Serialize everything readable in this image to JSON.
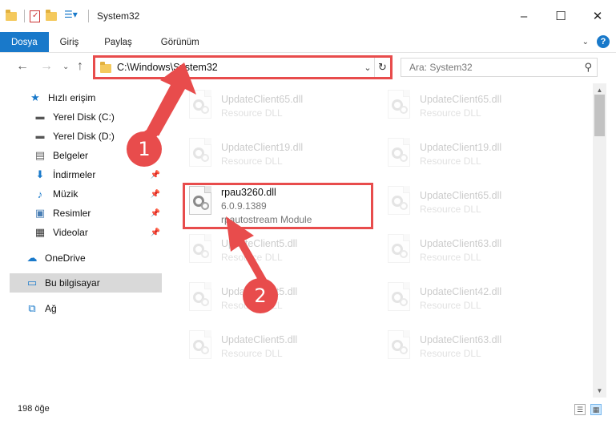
{
  "window": {
    "title": "System32",
    "controls": [
      "–",
      "☐",
      "✕"
    ]
  },
  "ribbon": {
    "tabs": [
      "Dosya",
      "Giriş",
      "Paylaş",
      "Görünüm"
    ],
    "help": "?"
  },
  "address": {
    "path": "C:\\Windows\\System32",
    "search_placeholder": "Ara: System32"
  },
  "sidebar": {
    "items": [
      {
        "label": "Hızlı erişim",
        "icon": "star-icon"
      },
      {
        "label": "Yerel Disk (C:)",
        "icon": "drive-icon"
      },
      {
        "label": "Yerel Disk (D:)",
        "icon": "drive-icon"
      },
      {
        "label": "Belgeler",
        "icon": "document-icon"
      },
      {
        "label": "İndirmeler",
        "icon": "download-icon"
      },
      {
        "label": "Müzik",
        "icon": "music-icon"
      },
      {
        "label": "Resimler",
        "icon": "pictures-icon"
      },
      {
        "label": "Videolar",
        "icon": "video-icon"
      },
      {
        "label": "OneDrive",
        "icon": "cloud-icon"
      },
      {
        "label": "Bu bilgisayar",
        "icon": "computer-icon"
      },
      {
        "label": "Ağ",
        "icon": "network-icon"
      }
    ]
  },
  "files": [
    {
      "name": "UpdateClient65.dll",
      "detail": "Resource DLL",
      "faded": true
    },
    {
      "name": "UpdateClient65.dll",
      "detail": "Resource DLL",
      "faded": true
    },
    {
      "name": "UpdateClient19.dll",
      "detail": "Resource DLL",
      "faded": true
    },
    {
      "name": "UpdateClient19.dll",
      "detail": "Resource DLL",
      "faded": true
    },
    {
      "name": "rpau3260.dll",
      "version": "6.0.9.1389",
      "detail": "rpautostream Module",
      "faded": false
    },
    {
      "name": "UpdateClient65.dll",
      "detail": "Resource DLL",
      "faded": true
    },
    {
      "name": "UpdateClient5.dll",
      "detail": "Resource DLL",
      "faded": true
    },
    {
      "name": "UpdateClient63.dll",
      "detail": "Resource DLL",
      "faded": true
    },
    {
      "name": "UpdateClient5.dll",
      "detail": "Resource DLL",
      "faded": true
    },
    {
      "name": "UpdateClient42.dll",
      "detail": "Resource DLL",
      "faded": true
    },
    {
      "name": "UpdateClient5.dll",
      "detail": "Resource DLL",
      "faded": true
    },
    {
      "name": "UpdateClient63.dll",
      "detail": "Resource DLL",
      "faded": true
    }
  ],
  "status": {
    "count": "198 öğe"
  },
  "annotations": {
    "badge1": "1",
    "badge2": "2",
    "color": "#e84c4c"
  }
}
